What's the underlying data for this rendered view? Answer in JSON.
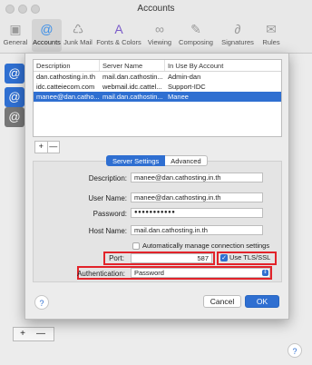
{
  "window": {
    "title": "Accounts"
  },
  "toolbar": {
    "items": [
      {
        "label": "General",
        "icon": "general-icon"
      },
      {
        "label": "Accounts",
        "icon": "at-sign-icon"
      },
      {
        "label": "Junk Mail",
        "icon": "trash-icon"
      },
      {
        "label": "Fonts & Colors",
        "icon": "fonts-icon"
      },
      {
        "label": "Viewing",
        "icon": "glasses-icon"
      },
      {
        "label": "Composing",
        "icon": "pencil-icon"
      },
      {
        "label": "Signatures",
        "icon": "signature-icon"
      },
      {
        "label": "Rules",
        "icon": "envelope-icon"
      }
    ]
  },
  "account_list": {
    "headers": [
      "Description",
      "Server Name",
      "In Use By Account"
    ],
    "rows": [
      {
        "description": "dan.cathosting.in.th",
        "server": "mail.dan.cathostin...",
        "in_use": "Admin-dan"
      },
      {
        "description": "idc.catteiecom.com",
        "server": "webmail.idc.cattel...",
        "in_use": "Support-IDC"
      },
      {
        "description": "manee@dan.catho...",
        "server": "mail.dan.cathostin...",
        "in_use": "Manee"
      }
    ],
    "add_label": "+",
    "remove_label": "—"
  },
  "tabs": {
    "server_settings": "Server Settings",
    "advanced": "Advanced"
  },
  "form": {
    "description_label": "Description:",
    "description_value": "manee@dan.cathosting.in.th",
    "username_label": "User Name:",
    "username_value": "manee@dan.cathosting.in.th",
    "password_label": "Password:",
    "password_value": "●●●●●●●●●●●",
    "hostname_label": "Host Name:",
    "hostname_value": "mail.dan.cathosting.in.th",
    "auto_manage_label": "Automatically manage connection settings",
    "port_label": "Port:",
    "port_value": "587",
    "tls_label": "Use TLS/SSL",
    "auth_label": "Authentication:",
    "auth_value": "Password"
  },
  "buttons": {
    "cancel": "Cancel",
    "ok": "OK",
    "help": "?"
  },
  "background": {
    "add": "+",
    "remove": "—"
  },
  "colors": {
    "accent": "#2f6fd1",
    "highlight": "#e2232a"
  }
}
